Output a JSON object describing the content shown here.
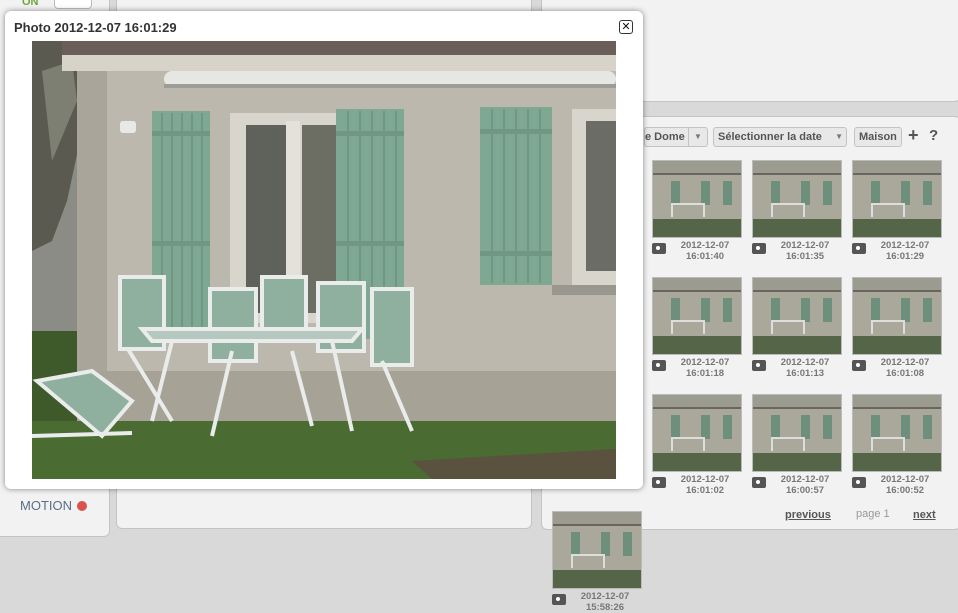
{
  "background": {
    "on_label": "ON",
    "motion_label": "MOTION",
    "motion_color": "#d9534f"
  },
  "toolbar": {
    "camera_select": "e Dome",
    "date_select": "Sélectionner la date",
    "house_button": "Maison",
    "add_icon": "plus-icon",
    "help_icon": "question-icon"
  },
  "thumbnails": [
    {
      "date": "2012-12-07",
      "time": "16:01:40"
    },
    {
      "date": "2012-12-07",
      "time": "16:01:35"
    },
    {
      "date": "2012-12-07",
      "time": "16:01:29"
    },
    {
      "date": "2012-12-07",
      "time": "16:01:18"
    },
    {
      "date": "2012-12-07",
      "time": "16:01:13"
    },
    {
      "date": "2012-12-07",
      "time": "16:01:08"
    },
    {
      "date": "2012-12-07",
      "time": "16:01:02"
    },
    {
      "date": "2012-12-07",
      "time": "16:00:57"
    },
    {
      "date": "2012-12-07",
      "time": "16:00:52"
    },
    {
      "date": "2012-12-07",
      "time": "15:58:26"
    }
  ],
  "pagination": {
    "previous": "previous",
    "page": "page 1",
    "next": "next"
  },
  "modal": {
    "title": "Photo 2012-12-07 16:01:29",
    "close_icon": "close-icon"
  }
}
